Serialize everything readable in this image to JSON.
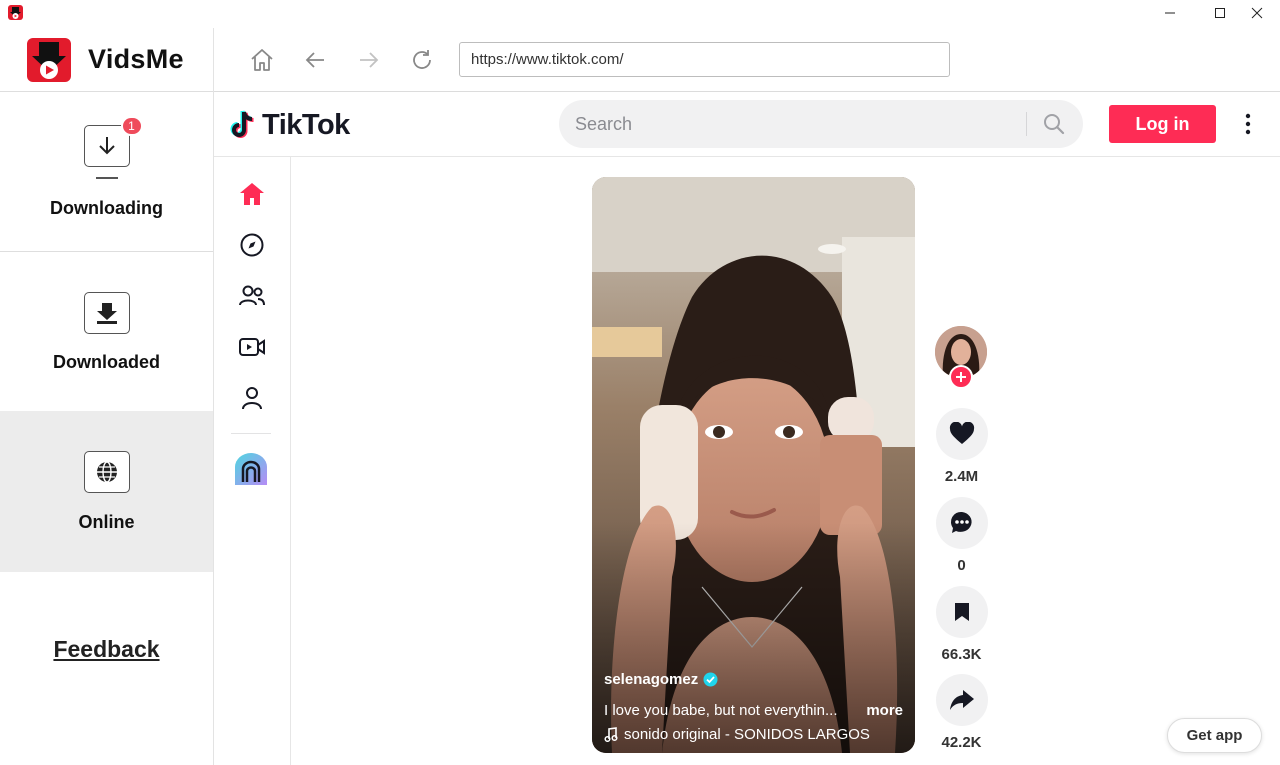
{
  "window": {
    "controls": {
      "minimize": "minimize-icon",
      "maximize": "maximize-icon",
      "close": "close-icon"
    }
  },
  "app": {
    "name": "VidsMe",
    "nav": [
      {
        "label": "Downloading",
        "icon": "download-arrow-icon",
        "badge": "1"
      },
      {
        "label": "Downloaded",
        "icon": "download-tray-icon"
      },
      {
        "label": "Online",
        "icon": "globe-icon",
        "active": true
      }
    ],
    "feedback": "Feedback"
  },
  "browser": {
    "url": "https://www.tiktok.com/",
    "buttons": [
      "home-icon",
      "back-arrow-icon",
      "forward-arrow-icon",
      "reload-icon"
    ]
  },
  "tiktok": {
    "brand": "TikTok",
    "search_placeholder": "Search",
    "login_label": "Log in",
    "rail": [
      "home-icon",
      "explore-icon",
      "following-icon",
      "live-icon",
      "profile-icon",
      "effect-house-icon"
    ],
    "video": {
      "author": "selenagomez",
      "description": "I love you babe, but not everythin...",
      "more_label": "more",
      "sound": "sonido original - SONIDOS LARGOS"
    },
    "actions": [
      {
        "icon": "heart-icon",
        "count": "2.4M"
      },
      {
        "icon": "comment-icon",
        "count": "0"
      },
      {
        "icon": "bookmark-icon",
        "count": "66.3K"
      },
      {
        "icon": "share-icon",
        "count": "42.2K"
      }
    ],
    "get_app_label": "Get app"
  },
  "colors": {
    "brand_red": "#fe2c55",
    "badge_red": "#ef4b5b",
    "active_nav_bg": "#ececec"
  }
}
